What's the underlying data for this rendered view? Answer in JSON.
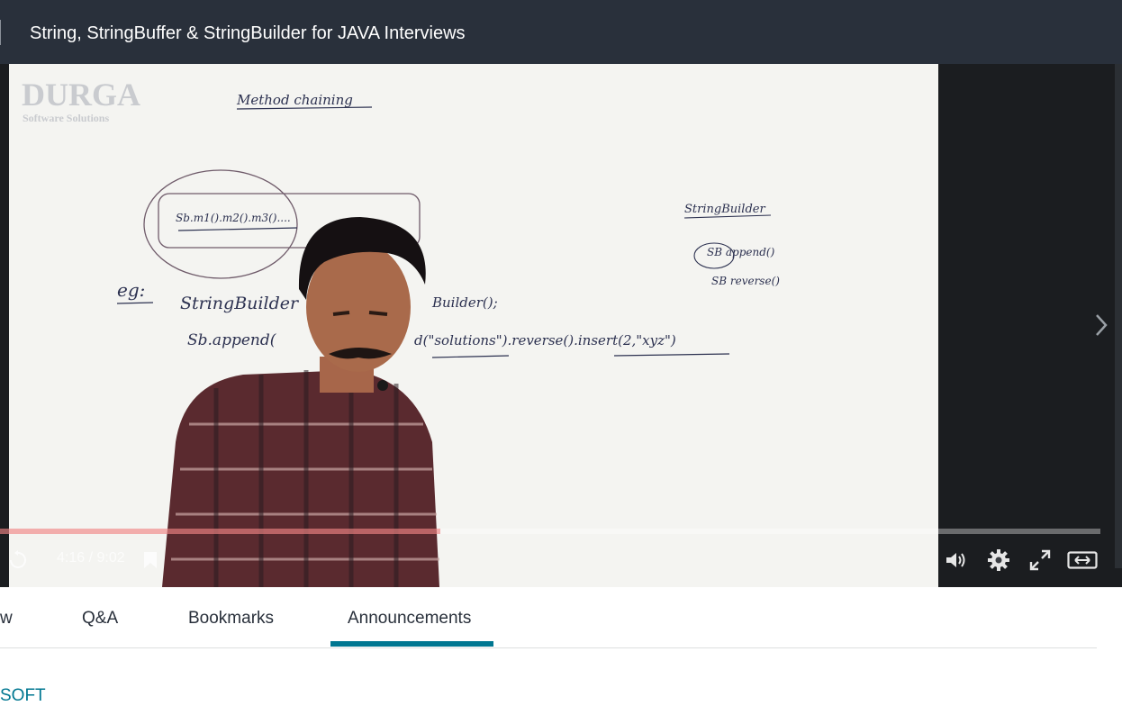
{
  "header": {
    "title": "String, StringBuffer & StringBuilder for JAVA Interviews"
  },
  "video": {
    "watermark_brand": "DURGA",
    "watermark_tagline": "Software Solutions",
    "whiteboard": {
      "heading": "Method chaining",
      "example_chain": "Sb.m1().m2().m3()....",
      "eg_label": "eg:",
      "line1": "StringBuilder",
      "line1_tail": "Builder();",
      "line2_head": "Sb.append(",
      "line2_mid": "d(\"solutions\").reverse().insert(2,\"xyz\")",
      "side_title": "StringBuilder",
      "side_items": [
        "SB   append()",
        "SB   reverse()"
      ]
    },
    "progress_fraction": 0.4,
    "time_display": "4:16 / 9:02"
  },
  "tabs": {
    "items": [
      {
        "label": "w"
      },
      {
        "label": "Q&A"
      },
      {
        "label": "Bookmarks"
      },
      {
        "label": "Announcements"
      }
    ],
    "active_index": 3,
    "accent": "#007791"
  },
  "author": {
    "name": "SOFT"
  }
}
